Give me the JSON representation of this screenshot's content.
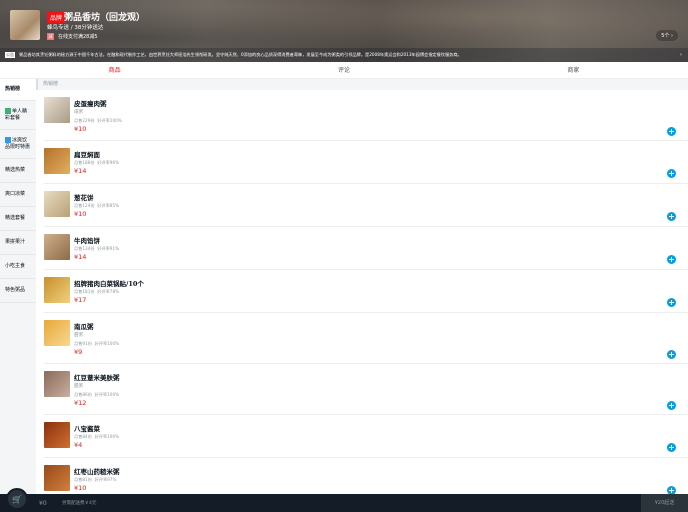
{
  "seller": {
    "brand_badge": "品牌",
    "name": "粥品香坊（回龙观）",
    "delivery": "蜂鸟专送 / 38分钟送达",
    "support_icon": "减",
    "support": "在线支付满28减5",
    "support_count": "5个 ›",
    "bulletin_label": "公告",
    "bulletin": "粥品香坊其烹饪粥料的秘方源于中国千年古法，在融和现代制作工艺，由世界烹饪大师屈浩先生领衔研发。坚守纯天然、0添加的良心品质深得消费者青睐，发展至今成为粥类的引领品牌。是2008年奥运会和2013年园博会指定餐饮服务商。",
    "bulletin_arrow": "›"
  },
  "tabs": [
    {
      "label": "商品"
    },
    {
      "label": "评论"
    },
    {
      "label": "商家"
    }
  ],
  "sidebar": [
    {
      "label": "热销榜"
    },
    {
      "label": "单人精彩套餐",
      "icon": "discount",
      "color": "#3cb371"
    },
    {
      "label": "冰爽饮品限时特惠",
      "icon": "special",
      "color": "#2e9be6"
    },
    {
      "label": "精选热菜"
    },
    {
      "label": "爽口凉菜"
    },
    {
      "label": "精选套餐"
    },
    {
      "label": "果拼果汁"
    },
    {
      "label": "小吃主食"
    },
    {
      "label": "特色粥品"
    }
  ],
  "category": "热销榜",
  "foods": [
    {
      "name": "皮蛋瘦肉粥",
      "desc": "咸粥",
      "sell": "月售229份",
      "rating": "好评率100%",
      "price": "¥10"
    },
    {
      "name": "扁豆焖面",
      "sell": "月售188份",
      "rating": "好评率96%",
      "price": "¥14"
    },
    {
      "name": "葱花饼",
      "sell": "月售124份",
      "rating": "好评率85%",
      "price": "¥10"
    },
    {
      "name": "牛肉馅饼",
      "sell": "月售134份",
      "rating": "好评率91%",
      "price": "¥14"
    },
    {
      "name": "招牌猪肉白菜锅贴/10个",
      "sell": "月售181份",
      "rating": "好评率78%",
      "price": "¥17"
    },
    {
      "name": "南瓜粥",
      "desc": "甜粥",
      "sell": "月售91份",
      "rating": "好评率100%",
      "price": "¥9"
    },
    {
      "name": "红豆薏米美肤粥",
      "desc": "甜粥",
      "sell": "月售86份",
      "rating": "好评率100%",
      "price": "¥12"
    },
    {
      "name": "八宝酱菜",
      "sell": "月售84份",
      "rating": "好评率100%",
      "price": "¥4"
    },
    {
      "name": "红枣山药糙米粥",
      "sell": "月售81份",
      "rating": "好评率97%",
      "price": "¥10"
    }
  ],
  "cart": {
    "total": "¥0",
    "delivery_fee": "另需配送费￥4元",
    "min_order": "¥20起送"
  },
  "colors": {
    "accent": "#f01414",
    "add": "#00a0dc",
    "footer": "#141d27"
  }
}
